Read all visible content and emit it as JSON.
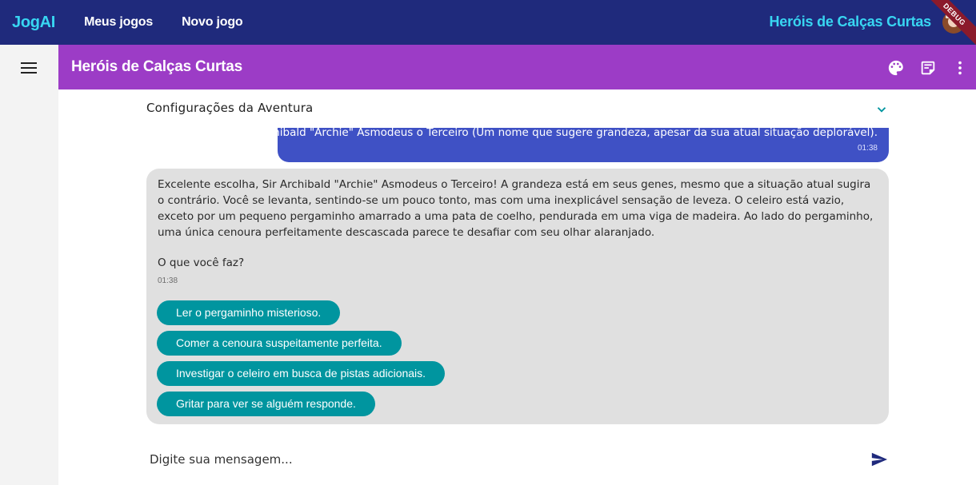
{
  "topbar": {
    "brand": "JogAI",
    "nav": [
      "Meus jogos",
      "Novo jogo"
    ],
    "game_title": "Heróis de Calças Curtas",
    "debug_label": "DEBUG"
  },
  "subbar": {
    "title": "Heróis de Calças Curtas",
    "icons": [
      "palette-icon",
      "notes-icon",
      "more-vert-icon"
    ]
  },
  "config": {
    "label": "Configurações da Aventura"
  },
  "user_message": {
    "text": "Archibald \"Archie\" Asmodeus o Terceiro (Um nome que sugere grandeza, apesar da sua atual situação deplorável).",
    "time": "01:38"
  },
  "ai_message": {
    "text": "Excelente escolha, Sir Archibald \"Archie\" Asmodeus o Terceiro!  A grandeza está em seus genes, mesmo que a situação atual sugira o contrário.  Você se levanta, sentindo-se um pouco tonto, mas com uma inexplicável sensação de leveza.  O celeiro está vazio, exceto por um pequeno pergaminho amarrado a uma pata de coelho, pendurada em uma viga de madeira.  Ao lado do pergaminho, uma única cenoura perfeitamente descascada parece te desafiar com seu olhar alaranjado.",
    "question": "O que você faz?",
    "time": "01:38",
    "choices": [
      "Ler o pergaminho misterioso.",
      "Comer a cenoura suspeitamente perfeita.",
      "Investigar o celeiro em busca de pistas adicionais.",
      "Gritar para ver se alguém responde."
    ]
  },
  "composer": {
    "placeholder": "Digite sua mensagem..."
  },
  "colors": {
    "topbar": "#1f2a7c",
    "brand": "#38d6f2",
    "subbar": "#9c3cc6",
    "user_bubble": "#3f51c5",
    "ai_bubble": "#e0e0e0",
    "choice": "#00959f"
  }
}
